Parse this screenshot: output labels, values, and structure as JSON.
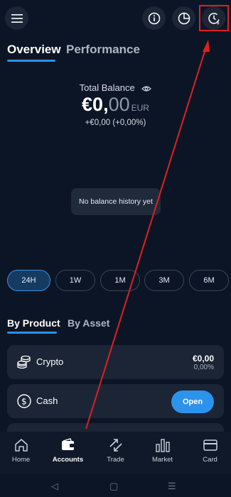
{
  "header": {
    "icons": {
      "menu": "menu-icon",
      "info": "info-icon",
      "pie": "pie-chart-icon",
      "history": "clock-dollar-icon"
    }
  },
  "tabs": [
    {
      "label": "Overview",
      "active": true
    },
    {
      "label": "Performance",
      "active": false
    }
  ],
  "balance": {
    "label": "Total Balance",
    "integer": "€0,",
    "decimals": "00",
    "currency": "EUR",
    "change": "+€0,00 (+0,00%)"
  },
  "chart": {
    "empty_message": "No balance history yet"
  },
  "ranges": [
    {
      "label": "24H",
      "active": true
    },
    {
      "label": "1W",
      "active": false
    },
    {
      "label": "1M",
      "active": false
    },
    {
      "label": "3M",
      "active": false
    },
    {
      "label": "6M",
      "active": false
    }
  ],
  "product_tabs": [
    {
      "label": "By Product",
      "active": true
    },
    {
      "label": "By Asset",
      "active": false
    }
  ],
  "products": {
    "crypto": {
      "label": "Crypto",
      "value": "€0,00",
      "percent": "0,00%"
    },
    "cash": {
      "label": "Cash",
      "button": "Open"
    }
  },
  "nav": [
    {
      "label": "Home",
      "icon": "home-icon",
      "active": false
    },
    {
      "label": "Accounts",
      "icon": "wallet-icon",
      "active": true
    },
    {
      "label": "Trade",
      "icon": "trade-arrows-icon",
      "active": false
    },
    {
      "label": "Market",
      "icon": "bar-chart-icon",
      "active": false
    },
    {
      "label": "Card",
      "icon": "card-icon",
      "active": false
    }
  ],
  "system_bar": {
    "back": "◁",
    "home": "▢",
    "recents": "☰"
  },
  "colors": {
    "background": "#0c1526",
    "accent": "#2d93ea",
    "annotation": "#e02020"
  }
}
